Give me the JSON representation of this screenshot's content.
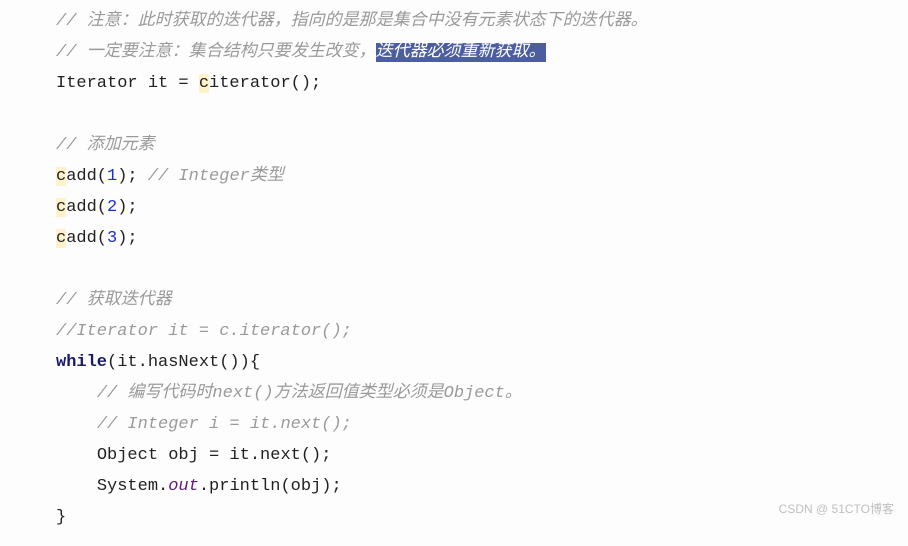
{
  "l1": {
    "c": "// 注意：此时获取的迭代器，指向的是那是集合中没有元素状态下的迭代器。"
  },
  "l2": {
    "c1": "// 一定要注意：集合结构只要发生改变，",
    "c2": "迭代器必须重新获取。"
  },
  "l3": {
    "p1": "Iterator it = ",
    "p2": "c",
    ".": ".",
    "m": "iterator();"
  },
  "l5": {
    "c": "// 添加元素"
  },
  "l6": {
    "p1": "c",
    ".": ".",
    "m": "add(",
    "n": "1",
    "p2": "); ",
    "c": "// Integer类型"
  },
  "l7": {
    "p1": "c",
    ".": ".",
    "m": "add(",
    "n": "2",
    "p2": ");"
  },
  "l8": {
    "p1": "c",
    ".": ".",
    "m": "add(",
    "n": "3",
    "p2": ");"
  },
  "l10": {
    "c": "// 获取迭代器"
  },
  "l11": {
    "c": "//Iterator it = c.iterator();"
  },
  "l12": {
    "kw": "while",
    "p": "(it.hasNext()){"
  },
  "l13": {
    "c": "// 编写代码时next()方法返回值类型必须是Object。"
  },
  "l14": {
    "c": "// Integer i = it.next();"
  },
  "l15": {
    "p": "Object obj = it.next();"
  },
  "l16": {
    "p1": "System.",
    "f": "out",
    "p2": ".println(obj);"
  },
  "l17": {
    "p": "}"
  },
  "watermark": "CSDN @ 51CTO博客"
}
